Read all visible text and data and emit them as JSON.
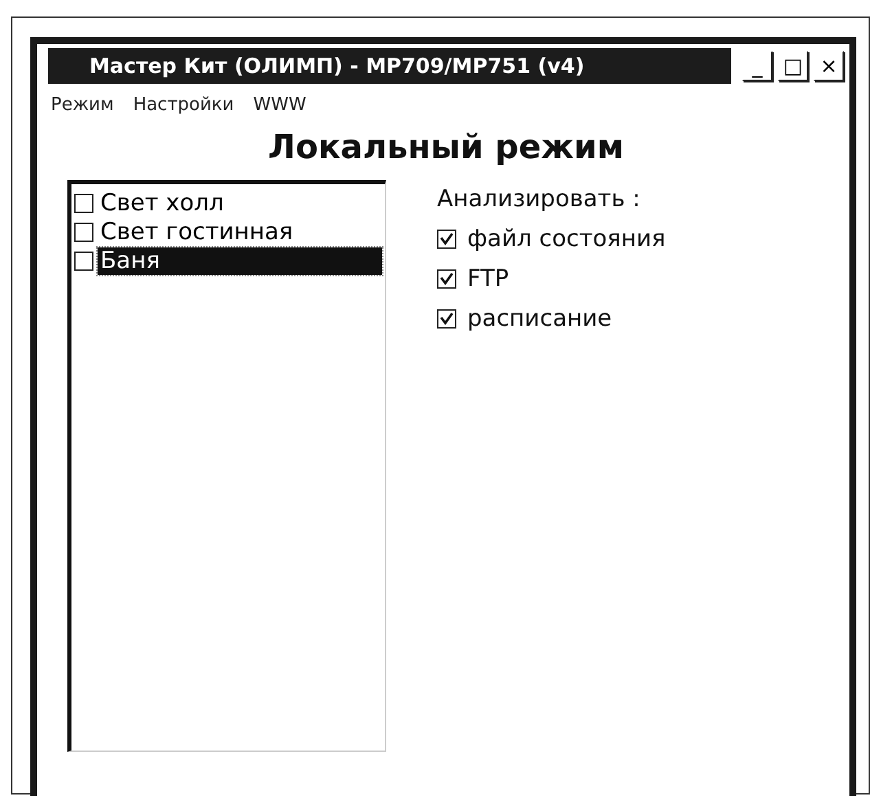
{
  "window": {
    "title": "Мастер Кит (ОЛИМП) - MP709/MP751 (v4)",
    "controls": [
      "_",
      "□",
      "×"
    ]
  },
  "menu": [
    "Режим",
    "Настройки",
    "WWW"
  ],
  "heading": "Локальный режим",
  "devices": [
    {
      "label": "Свет холл",
      "checked": false,
      "selected": false
    },
    {
      "label": "Свет гостинная",
      "checked": false,
      "selected": false
    },
    {
      "label": "Баня",
      "checked": false,
      "selected": true
    }
  ],
  "analyze": {
    "label": "Анализировать :",
    "options": [
      {
        "label": "файл состояния",
        "checked": true
      },
      {
        "label": "FTP",
        "checked": true
      },
      {
        "label": "расписание",
        "checked": true
      }
    ]
  }
}
